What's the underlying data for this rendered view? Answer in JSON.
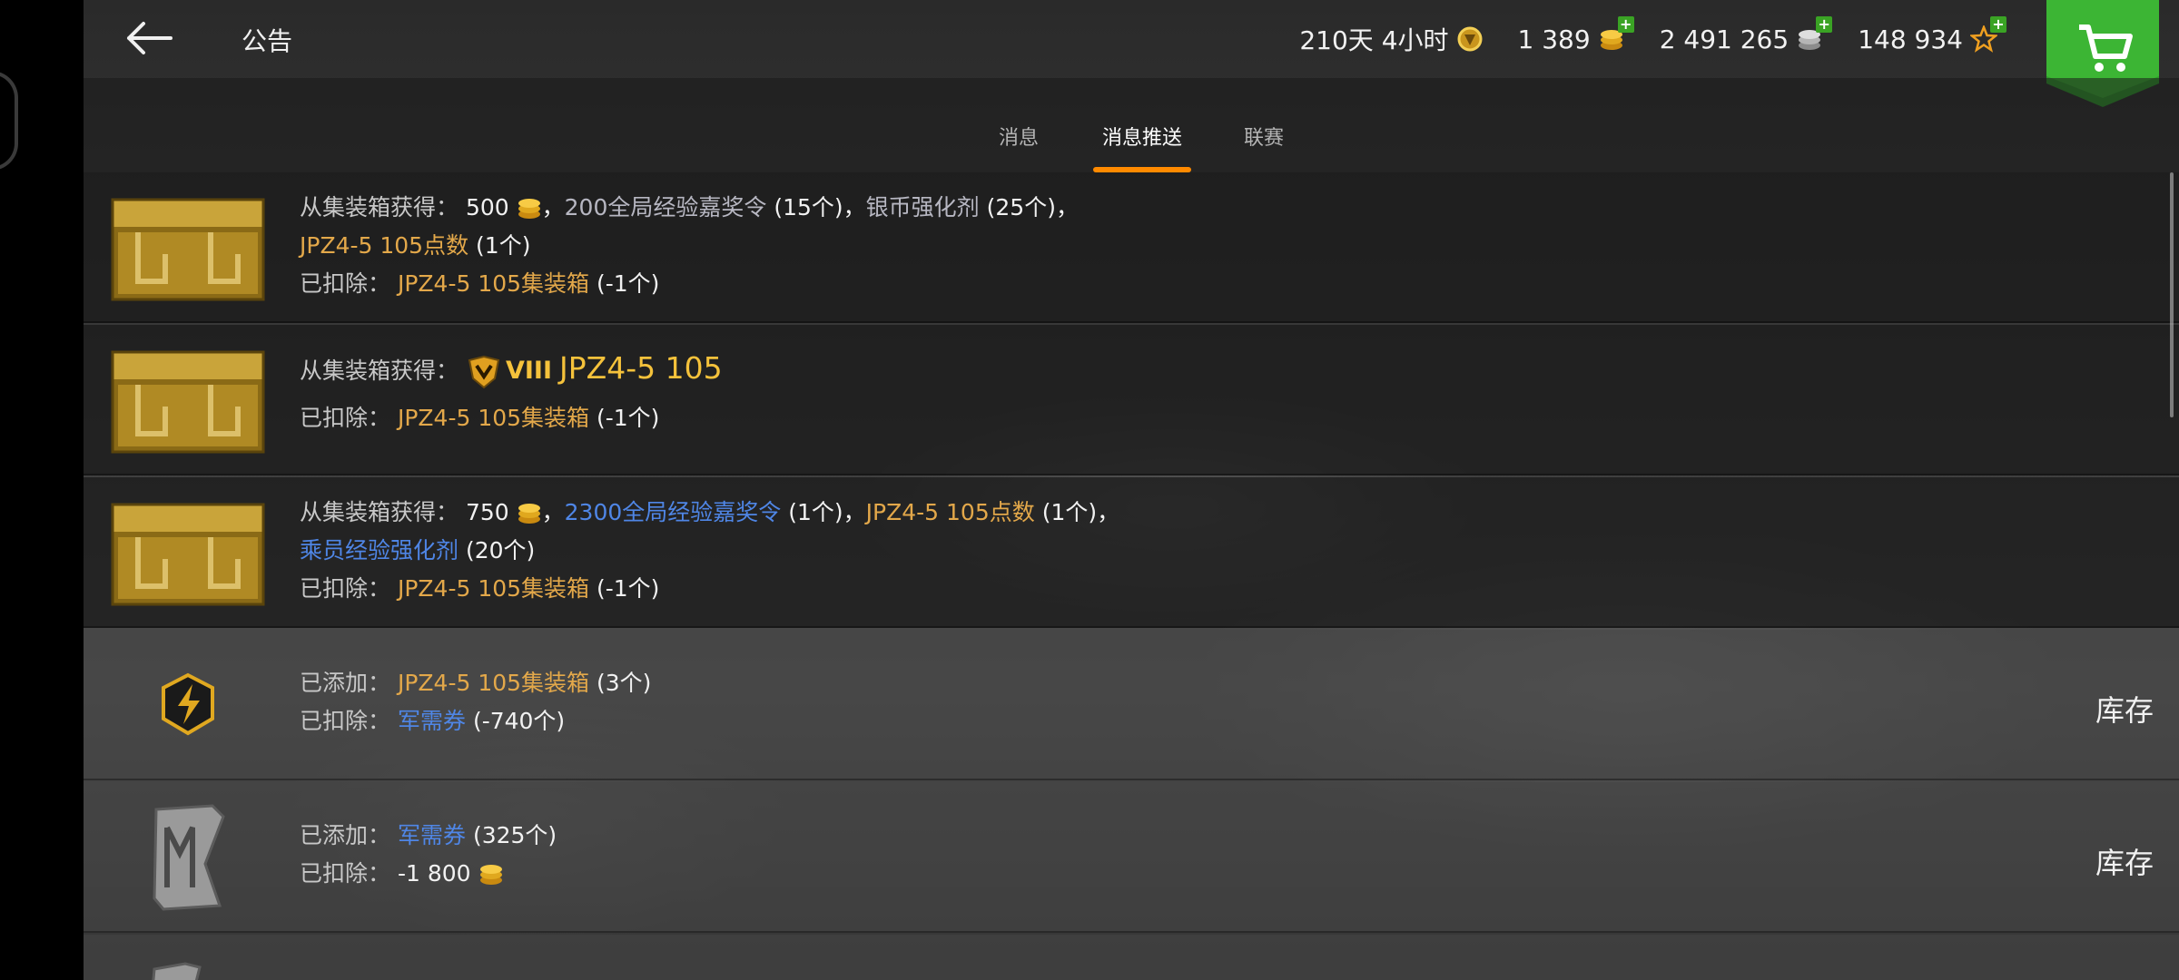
{
  "header": {
    "title": "公告",
    "premium_time": "210天 4小时",
    "gold": "1 389",
    "silver": "2 491 265",
    "free_xp": "148 934"
  },
  "tabs": [
    {
      "label": "消息",
      "active": false
    },
    {
      "label": "消息推送",
      "active": true
    },
    {
      "label": "联赛",
      "active": false
    }
  ],
  "rows": [
    {
      "icon": "golden-container-icon",
      "received_label": "从集装箱获得：",
      "items_line1": [
        "500",
        "200全局经验嘉奖令",
        "(15个)",
        "银币强化剂",
        "(25个)"
      ],
      "items_line2": [
        "JPZ4-5 105点数",
        "(1个)"
      ],
      "deducted_label": "已扣除：",
      "deducted_item": "JPZ4-5 105集装箱",
      "deducted_qty": "(-1个)"
    },
    {
      "icon": "golden-container-icon",
      "received_label": "从集装箱获得：",
      "tier": "VIII",
      "tank": "JPZ4-5 105",
      "deducted_label": "已扣除：",
      "deducted_item": "JPZ4-5 105集装箱",
      "deducted_qty": "(-1个)"
    },
    {
      "icon": "golden-container-icon",
      "received_label": "从集装箱获得：",
      "items_line1": [
        "750",
        "2300全局经验嘉奖令",
        "(1个)",
        "JPZ4-5 105点数",
        "(1个)"
      ],
      "items_line2": [
        "乘员经验强化剂",
        "(20个)"
      ],
      "deducted_label": "已扣除：",
      "deducted_item": "JPZ4-5 105集装箱",
      "deducted_qty": "(-1个)"
    },
    {
      "icon": "lightning-shield-icon",
      "added_label": "已添加：",
      "added_item": "JPZ4-5 105集装箱",
      "added_qty": "(3个)",
      "deducted_label": "已扣除：",
      "deducted_item": "军需券",
      "deducted_qty": "(-740个)",
      "action": "库存"
    },
    {
      "icon": "voucher-ticket-icon",
      "added_label": "已添加：",
      "added_item": "军需券",
      "added_qty": "(325个)",
      "deducted_label": "已扣除：",
      "deducted_value": "-1 800",
      "action": "库存"
    }
  ],
  "colors": {
    "accent": "#ff8a00",
    "gold_text": "#e3a84a",
    "blue_text": "#4f86e6",
    "shop_green": "#3aa324"
  }
}
